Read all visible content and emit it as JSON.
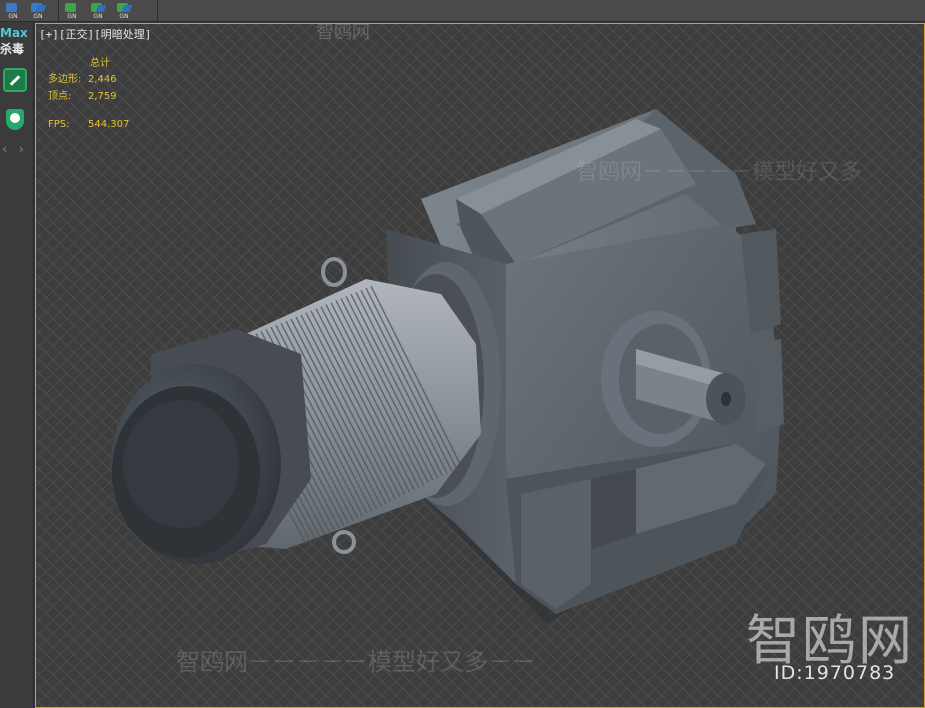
{
  "toolbar": {
    "left_buttons": [
      {
        "icon": "blue-cube-icon",
        "label": "GN"
      },
      {
        "icon": "blue-arrow-cube-icon",
        "label": "GN"
      }
    ],
    "right_buttons": [
      {
        "icon": "green-cube-icon",
        "label": "GN"
      },
      {
        "icon": "green-arrow-cube-icon",
        "label": "GN"
      },
      {
        "icon": "green-arrow-cube-icon",
        "label": "GN"
      }
    ]
  },
  "sidebar": {
    "app_label": "Max",
    "antivirus_label": "杀毒",
    "icons": [
      "clean-icon",
      "shield-icon"
    ],
    "nav": "‹ ›"
  },
  "viewport": {
    "label": "[+][正交][明暗处理]",
    "stats": {
      "total_label": "总计",
      "polygons_label": "多边形:",
      "polygons_value": "2,446",
      "vertices_label": "顶点:",
      "vertices_value": "2,759",
      "fps_label": "FPS:",
      "fps_value": "544.307"
    }
  },
  "watermarks": {
    "main": "智鸥网－－－－－模型好又多－－",
    "mid": "智鸥网－－－－－模型好又多",
    "top": "智鸥网",
    "big": "智鸥网",
    "id": "ID:1970783"
  },
  "colors": {
    "viewport_border": "#c9a52c",
    "stats_text": "#e2c33a",
    "max_label": "#56c6d3"
  }
}
